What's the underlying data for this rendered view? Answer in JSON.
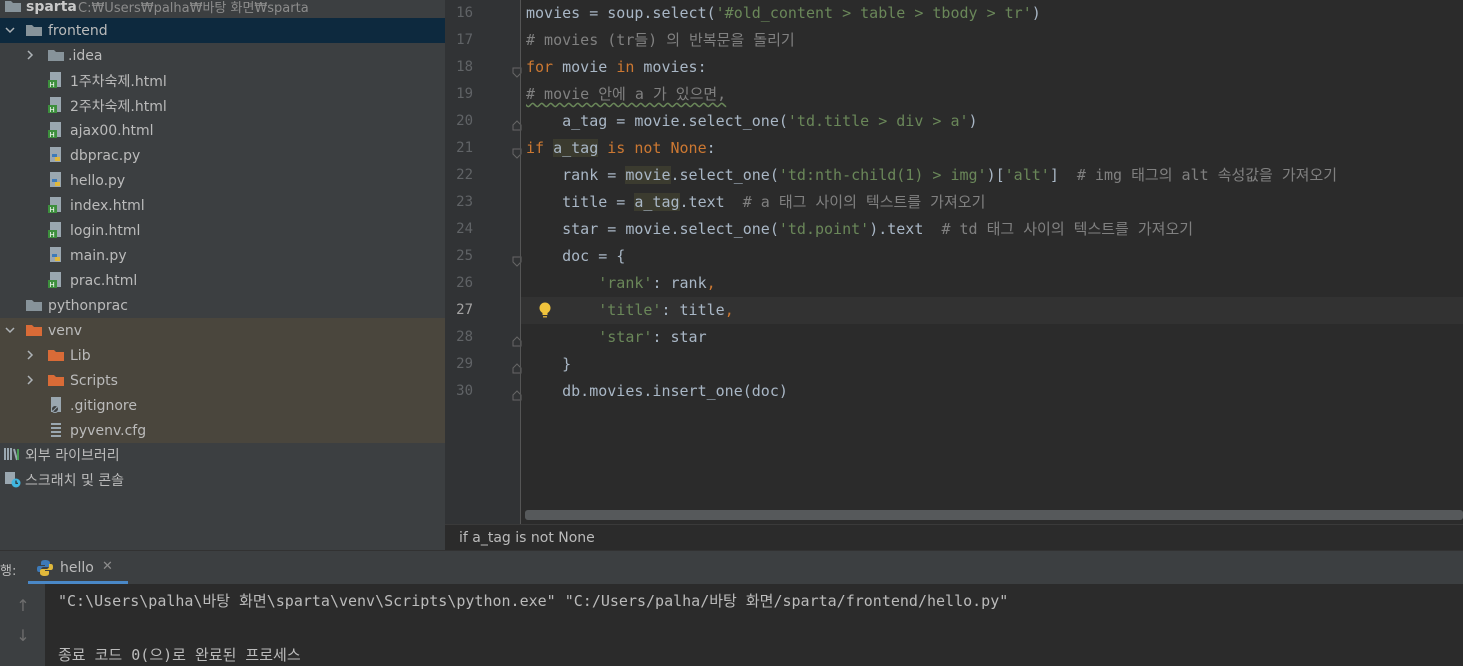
{
  "project": {
    "root": {
      "label": "sparta",
      "path": "C:₩Users₩palha₩바탕 화면₩sparta"
    },
    "items": [
      {
        "label": "frontend",
        "kind": "folder"
      },
      {
        "label": ".idea",
        "kind": "folder"
      },
      {
        "label": "1주차숙제.html",
        "kind": "html"
      },
      {
        "label": "2주차숙제.html",
        "kind": "html"
      },
      {
        "label": "ajax00.html",
        "kind": "html"
      },
      {
        "label": "dbprac.py",
        "kind": "python"
      },
      {
        "label": "hello.py",
        "kind": "python"
      },
      {
        "label": "index.html",
        "kind": "html"
      },
      {
        "label": "login.html",
        "kind": "html"
      },
      {
        "label": "main.py",
        "kind": "python"
      },
      {
        "label": "prac.html",
        "kind": "html"
      },
      {
        "label": "pythonprac",
        "kind": "folder"
      },
      {
        "label": "venv",
        "kind": "folder-excluded"
      },
      {
        "label": "Lib",
        "kind": "folder-excluded"
      },
      {
        "label": "Scripts",
        "kind": "folder-excluded"
      },
      {
        "label": ".gitignore",
        "kind": "gitignore"
      },
      {
        "label": "pyvenv.cfg",
        "kind": "config"
      }
    ],
    "external_libraries": "외부 라이브러리",
    "scratches": "스크래치 및 콘솔"
  },
  "editor": {
    "current_line": 27,
    "lines": [
      {
        "n": "16"
      },
      {
        "n": "17"
      },
      {
        "n": "18"
      },
      {
        "n": "19"
      },
      {
        "n": "20"
      },
      {
        "n": "21"
      },
      {
        "n": "22"
      },
      {
        "n": "23"
      },
      {
        "n": "24"
      },
      {
        "n": "25"
      },
      {
        "n": "26"
      },
      {
        "n": "27"
      },
      {
        "n": "28"
      },
      {
        "n": "29"
      },
      {
        "n": "30"
      }
    ],
    "code": {
      "l16a": "movies = soup.select(",
      "l16b": "'#old_content > table > tbody > tr'",
      "l16c": ")",
      "l17": "# movies (tr들) 의 반복문을 돌리기",
      "l18a": "for",
      "l18b": " movie ",
      "l18c": "in",
      "l18d": " movies:",
      "l19": "# movie 안에 a 가 있으면,",
      "l20a": "    a_tag = movie.select_one(",
      "l20b": "'td.title > div > a'",
      "l20c": ")",
      "l21a": "if",
      "l21b": "a_tag",
      "l21c": "is not",
      "l21d": "None",
      "l21e": ":",
      "l22a": "    rank = ",
      "l22b": "movie",
      "l22c": ".select_one(",
      "l22d": "'td:nth-child(1) > img'",
      "l22e": ")[",
      "l22f": "'alt'",
      "l22g": "]  ",
      "l22h": "# img 태그의 alt 속성값을 가져오기",
      "l23a": "    title = ",
      "l23b": "a_tag",
      "l23c": ".text  ",
      "l23d": "# a 태그 사이의 텍스트를 가져오기",
      "l24a": "    star = movie.select_one(",
      "l24b": "'td.point'",
      "l24c": ").text  ",
      "l24d": "# td 태그 사이의 텍스트를 가져오기",
      "l25": "    doc = {",
      "l26a": "'rank'",
      "l26b": ": rank",
      "l26c": ",",
      "l27a": "'title'",
      "l27b": ": title",
      "l27c": ",",
      "l28a": "'star'",
      "l28b": ": star",
      "l29": "    }",
      "l30": "    db.movies.insert_one(doc)"
    }
  },
  "breadcrumb": "if a_tag is not None",
  "run": {
    "prefix": "행:",
    "tab_label": "hello",
    "output": [
      "\"C:\\Users\\palha\\바탕 화면\\sparta\\venv\\Scripts\\python.exe\" \"C:/Users/palha/바탕 화면/sparta/frontend/hello.py\"",
      "",
      "종료 코드 0(으)로 완료된 프로세스"
    ]
  },
  "colors": {
    "keyword": "#cc7832",
    "string": "#6a8759",
    "comment": "#808080",
    "selection": "#0d293e",
    "excluded": "#4a463d",
    "accent": "#4a88c7"
  }
}
